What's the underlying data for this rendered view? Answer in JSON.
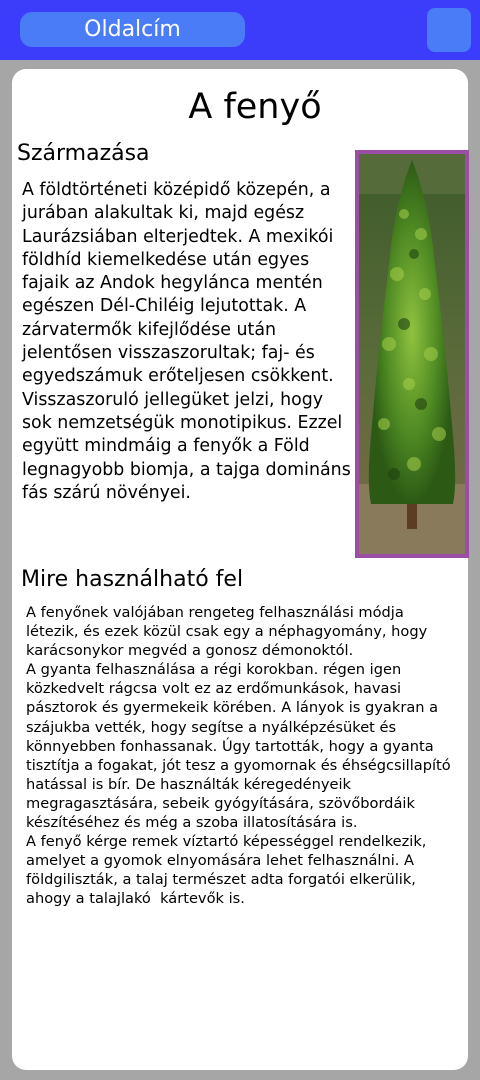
{
  "header": {
    "title": "Oldalcím"
  },
  "article": {
    "title": "A fenyő",
    "sections": [
      {
        "heading": "Származása",
        "text": "A földtörténeti középidő közepén, a jurában alakultak ki, majd egész Laurázsiában elterjedtek. A mexikói földhíd kiemelkedése után egyes fajaik az Andok hegylánca mentén egészen Dél-Chiléig lejutottak. A zárvatermők kifejlődése után jelentősen visszaszorultak; faj- és egyedszámuk erőteljesen csökkent. Visszaszoruló jellegüket jelzi, hogy sok nemzetségük monotipikus. Ezzel együtt mindmáig a fenyők a Föld legnagyobb biomja, a tajga domináns fás szárú növényei."
      },
      {
        "heading": "Mire használható fel",
        "text": "A fenyőnek valójában rengeteg felhasználási módja létezik, és ezek közül csak egy a néphagyomány, hogy karácsonykor megvéd a gonosz démonoktól.\nA gyanta felhasználása a régi korokban. régen igen közkedvelt rágcsa volt ez az erdőmunkások, havasi pásztorok és gyermekeik körében. A lányok is gyakran a szájukba vették, hogy segítse a nyálképzésüket és könnyebben fonhassanak. Úgy tartották, hogy a gyanta tisztítja a fogakat, jót tesz a gyomornak és éhségcsillapító hatással is bír. De használták kéregedényeik megragasztására, sebeik gyógyítására, szövőbordáik készítéséhez és még a szoba illatosítására is.\nA fenyő kérge remek víztartó képességgel rendelkezik, amelyet a gyomok elnyomására lehet felhasználni. A földgiliszták, a talaj természet adta forgatói elkerülik, ahogy a talajlakó  kártevők is."
      }
    ]
  },
  "colors": {
    "topbar": "#3c3cfb",
    "pill": "#4a7cf7",
    "background": "#a6a6a6",
    "image_border": "#9a4fa4"
  }
}
